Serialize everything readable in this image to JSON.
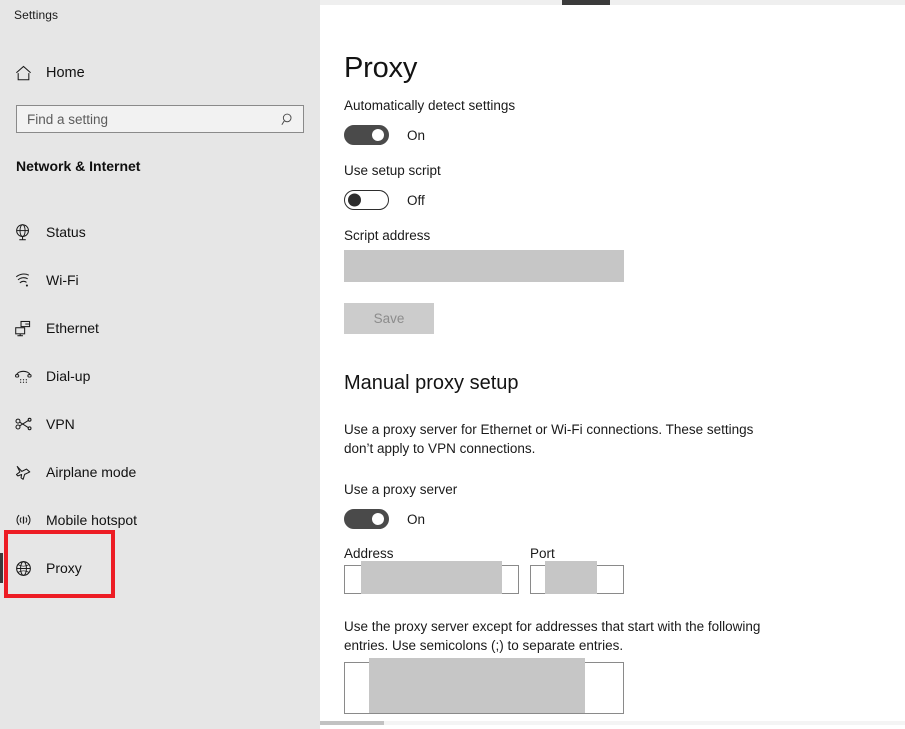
{
  "app": {
    "title": "Settings"
  },
  "sidebar": {
    "home": {
      "label": "Home",
      "icon": "home-icon"
    },
    "search": {
      "placeholder": "Find a setting",
      "value": "",
      "icon": "search-icon"
    },
    "category": "Network & Internet",
    "items": [
      {
        "label": "Status",
        "icon": "globe-status-icon",
        "selected": false
      },
      {
        "label": "Wi-Fi",
        "icon": "wifi-icon",
        "selected": false
      },
      {
        "label": "Ethernet",
        "icon": "ethernet-icon",
        "selected": false
      },
      {
        "label": "Dial-up",
        "icon": "dialup-phone-icon",
        "selected": false
      },
      {
        "label": "VPN",
        "icon": "vpn-key-icon",
        "selected": false
      },
      {
        "label": "Airplane mode",
        "icon": "airplane-icon",
        "selected": false
      },
      {
        "label": "Mobile hotspot",
        "icon": "hotspot-icon",
        "selected": false
      },
      {
        "label": "Proxy",
        "icon": "globe-icon",
        "selected": true
      }
    ],
    "highlight": {
      "target": "Proxy",
      "color": "#ed1c24"
    }
  },
  "main": {
    "title": "Proxy",
    "automatic": {
      "detect_label": "Automatically detect settings",
      "detect_state": "On",
      "setup_script_label": "Use setup script",
      "setup_script_state": "Off",
      "script_address_label": "Script address",
      "script_address_value": "",
      "save_label": "Save"
    },
    "manual": {
      "heading": "Manual proxy setup",
      "description": "Use a proxy server for Ethernet or Wi-Fi connections. These settings don’t apply to VPN connections.",
      "use_proxy_label": "Use a proxy server",
      "use_proxy_state": "On",
      "address_label": "Address",
      "address_value": "",
      "port_label": "Port",
      "port_value": "",
      "exceptions_description": "Use the proxy server except for addresses that start with the following entries. Use semicolons (;) to separate entries.",
      "exceptions_value": ""
    }
  }
}
